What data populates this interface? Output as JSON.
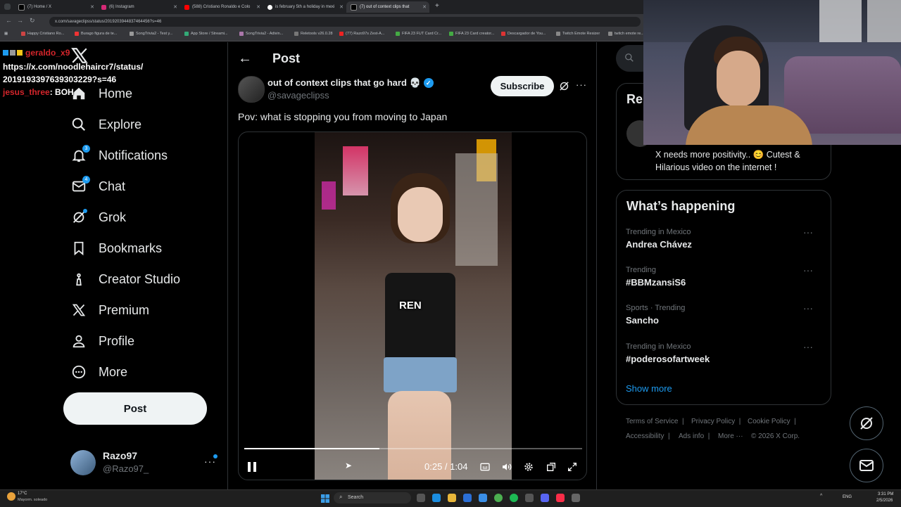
{
  "browser": {
    "tabs": [
      {
        "label": "(7) Home / X",
        "color": "#000000"
      },
      {
        "label": "(6) Instagram",
        "color": "#d62976"
      },
      {
        "label": "(588) Cristiano Ronaldo e Colo",
        "color": "#ff0000"
      },
      {
        "label": "is february 5th a holiday in mexi",
        "color": "#ffffff"
      },
      {
        "label": "(7) out of context clips that",
        "color": "#000000"
      }
    ],
    "new_tab": "+",
    "url": "x.com/savageclipss/status/2019203944837464456?s=46",
    "bookmarks": [
      "Happy Cristiano Ro...",
      "Burago figura de te...",
      "SongTrivia2 - Test y...",
      "App Store / Streami...",
      "SongTrivia2 - Adivin...",
      "Reletools v26.0.28",
      "(77) Razo97s Zest-A...",
      "FIFA 23 FUT Card Cr...",
      "FIFA 23 Card creator...",
      "Descargador de You...",
      "Twitch Emote Resizer",
      "twitch emote re..."
    ]
  },
  "chat_overlay": {
    "user1": "geraldo_x9",
    "link_line1": "https://x.com/noodlehaircr7/status/",
    "link_line2": "2019193397639303229?s=46",
    "user2": "jesus_three",
    "msg2": ": BOH"
  },
  "nav": {
    "items": [
      {
        "label": "Home",
        "icon": "home-icon"
      },
      {
        "label": "Explore",
        "icon": "search-icon"
      },
      {
        "label": "Notifications",
        "icon": "bell-icon",
        "badge": "3"
      },
      {
        "label": "Chat",
        "icon": "mail-icon",
        "badge": "4"
      },
      {
        "label": "Grok",
        "icon": "grok-icon"
      },
      {
        "label": "Bookmarks",
        "icon": "bookmark-icon"
      },
      {
        "label": "Creator Studio",
        "icon": "creator-studio-icon"
      },
      {
        "label": "Premium",
        "icon": "x-logo-icon"
      },
      {
        "label": "Profile",
        "icon": "person-icon"
      },
      {
        "label": "More",
        "icon": "more-circle-icon"
      }
    ],
    "post_button": "Post",
    "account": {
      "name": "Razo97",
      "handle": "@Razo97_"
    }
  },
  "main": {
    "header_title": "Post",
    "author_name": "out of context clips that go hard 💀",
    "author_handle": "@savageclipss",
    "subscribe": "Subscribe",
    "tweet_text": "Pov: what is stopping you from moving to Japan",
    "video": {
      "caption": "REN",
      "time": "0:25 / 1:04",
      "progress": 0.4
    }
  },
  "right": {
    "search_placeholder": "Search",
    "relevant_title": "Relevant people",
    "relevant_text": "X needs more positivity.. 😊 Cutest & Hilarious video on the internet !",
    "happening_title": "What’s happening",
    "trends": [
      {
        "meta": "Trending in Mexico",
        "title": "Andrea Chávez"
      },
      {
        "meta": "Trending",
        "title": "#BBMzansiS6"
      },
      {
        "meta": "Sports · Trending",
        "title": "Sancho"
      },
      {
        "meta": "Trending in Mexico",
        "title": "#poderosofartweek"
      }
    ],
    "show_more": "Show more",
    "footer": [
      "Terms of Service",
      "Privacy Policy",
      "Cookie Policy",
      "Accessibility",
      "Ads info",
      "More ···",
      "© 2026 X Corp."
    ]
  },
  "taskbar": {
    "weather_temp": "17°C",
    "weather_desc": "Mayorm. soleado",
    "search": "Search",
    "lang": "ENG",
    "time": "3:31 PM",
    "date": "2/5/2026"
  },
  "colors": {
    "accent": "#1d9bf0",
    "bg": "#000000",
    "border": "#2f3336",
    "muted": "#71767b"
  }
}
